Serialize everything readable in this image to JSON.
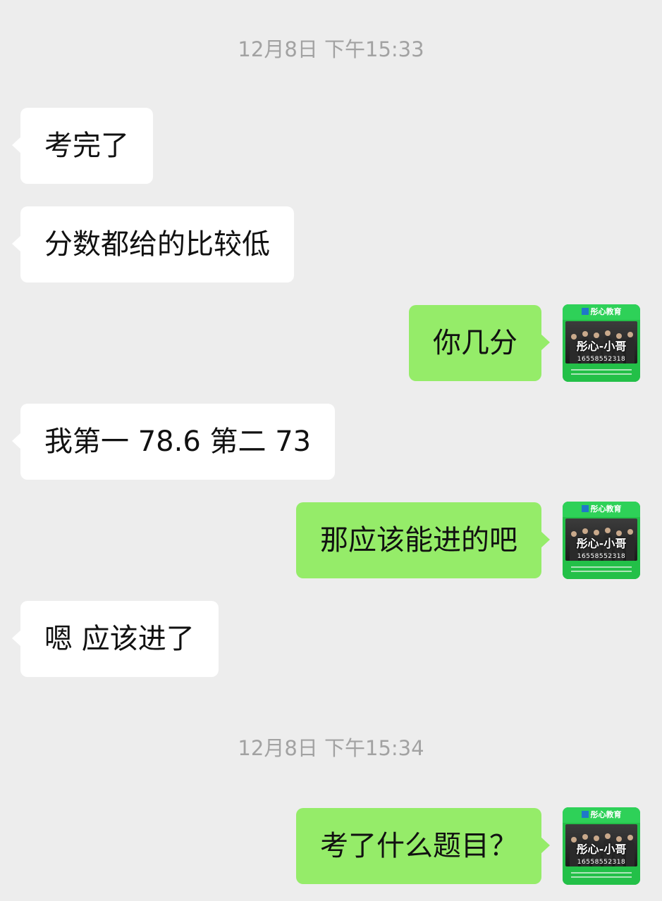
{
  "timestamps": [
    "12月8日 下午15:33",
    "12月8日 下午15:34"
  ],
  "messages": [
    {
      "side": "in",
      "text": "考完了"
    },
    {
      "side": "in",
      "text": "分数都给的比较低"
    },
    {
      "side": "out",
      "text": "你几分"
    },
    {
      "side": "in",
      "text": "我第一 78.6 第二 73"
    },
    {
      "side": "out",
      "text": "那应该能进的吧"
    },
    {
      "side": "in",
      "text": "嗯 应该进了"
    },
    {
      "side": "out",
      "text": "考了什么题目？"
    }
  ],
  "avatar": {
    "name": "彤心-小哥",
    "header": "彤心教育",
    "phone": "16558552318",
    "background_color": "#23c048"
  },
  "colors": {
    "background": "#ededed",
    "incoming_bubble": "#ffffff",
    "outgoing_bubble": "#95ec69",
    "timestamp_text": "#a2a2a2"
  }
}
